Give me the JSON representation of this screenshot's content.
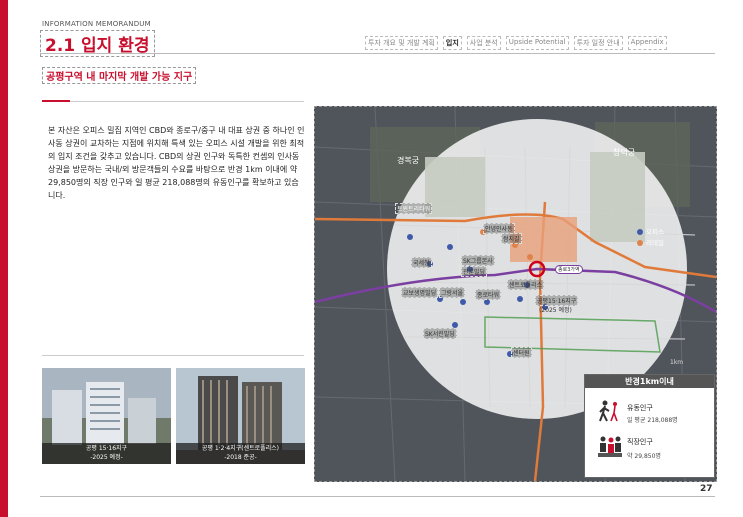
{
  "header": {
    "doc_type": "INFORMATION MEMORANDUM",
    "section_title": "2.1 입지 환경",
    "nav": [
      "투자 개요 및 개발 계획",
      "입지",
      "사업 분석",
      "Upside Potential",
      "투자 일정 안내",
      "Appendix"
    ],
    "active_nav_index": 1
  },
  "subtitle": "공평구역 내 마지막 개발 가능 지구",
  "body_text": "본 자산은 오피스 밀집 지역인 CBD와 종로구/중구 내 대표 상권 중 하나인 인사동 상권이 교차하는 지점에 위치해 특색 있는 오피스 시설 개발을 위한 최적의 입지 조건을 갖추고 있습니다. CBD의 상권 인구와 독특한 컨셉의 인사동 상권을 방문하는 국내/외 방문객들의 수요를 바탕으로 반경 1km 이내에 약 29,850명의 직장 인구와 일 평균 218,088명의 유동인구를 확보하고 있습니다.",
  "photos": [
    {
      "caption_line1": "공평 15·16지구",
      "caption_line2": "-2025 예정-"
    },
    {
      "caption_line1": "공평 1·2·4지구(센트로폴리스)",
      "caption_line2": "-2018 준공-"
    }
  ],
  "map": {
    "legend": [
      {
        "label": "오피스",
        "color": "#3f5aa8"
      },
      {
        "label": "리테일",
        "color": "#e0834a"
      }
    ],
    "areas": [
      "경복궁",
      "창덕궁"
    ],
    "labels": [
      "트윈트리타워",
      "안녕인사동",
      "쌈지길",
      "국세청",
      "SK그룹본사",
      "관훈빌딩",
      "교보생명빌딩",
      "그랑서울",
      "종로타워",
      "센트로폴리스",
      "공평15·16지구",
      "(2025 예정)",
      "SK서린빌딩",
      "센터원",
      "종로3가역"
    ],
    "radius_label": "1km",
    "colors": {
      "orange_line": "#e07a3a",
      "purple_line": "#7a3fa0",
      "site_marker": "#d0021b"
    }
  },
  "info_box": {
    "title": "반경1km이내",
    "flow_label": "유동인구",
    "flow_value": "일 평균 218,088명",
    "worker_label": "직장인구",
    "worker_value": "약 29,850명"
  },
  "page_number": "27"
}
